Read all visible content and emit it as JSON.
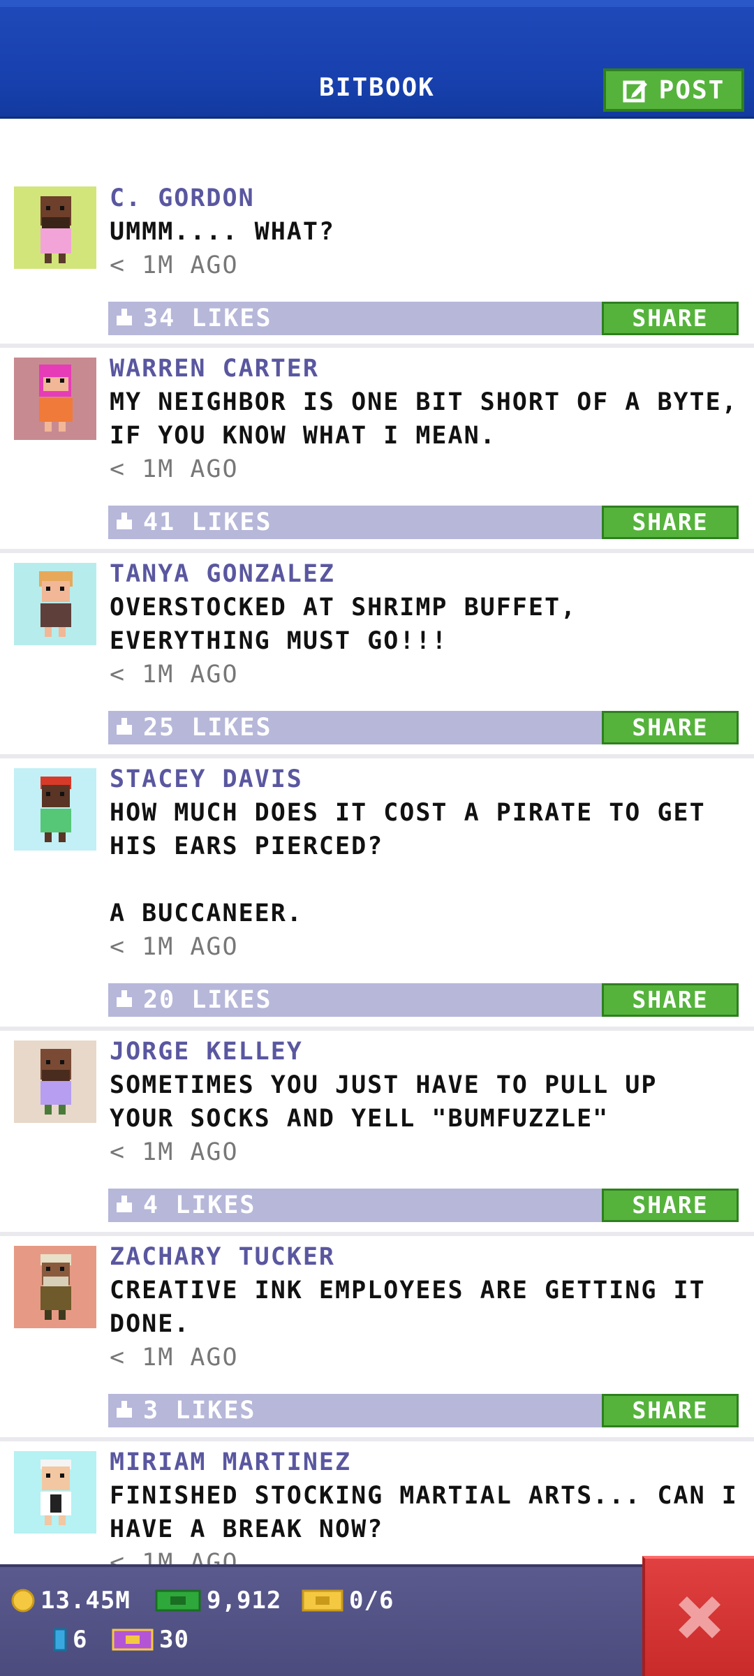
{
  "header": {
    "title": "BITBOOK",
    "post_label": "POST"
  },
  "posts": [
    {
      "author": "C. GORDON",
      "message": "UMMM....  WHAT?",
      "time": "< 1M AGO",
      "likes": "34 LIKES",
      "share": "SHARE",
      "avatar_bg": "#d2e57b"
    },
    {
      "author": "WARREN CARTER",
      "message": "MY NEIGHBOR IS ONE BIT SHORT OF A BYTE,\nIF YOU KNOW WHAT I MEAN.",
      "time": "< 1M AGO",
      "likes": "41 LIKES",
      "share": "SHARE",
      "avatar_bg": "#c88a91"
    },
    {
      "author": "TANYA GONZALEZ",
      "message": "OVERSTOCKED AT SHRIMP BUFFET,\nEVERYTHING MUST GO!!!",
      "time": "< 1M AGO",
      "likes": "25 LIKES",
      "share": "SHARE",
      "avatar_bg": "#b7ecec"
    },
    {
      "author": "STACEY DAVIS",
      "message": "HOW MUCH DOES IT COST A PIRATE TO GET\nHIS EARS PIERCED?\n\nA BUCCANEER.",
      "time": "< 1M AGO",
      "likes": "20 LIKES",
      "share": "SHARE",
      "avatar_bg": "#c3eff6"
    },
    {
      "author": "JORGE KELLEY",
      "message": "SOMETIMES YOU JUST HAVE TO PULL UP\nYOUR SOCKS AND YELL \"BUMFUZZLE\"",
      "time": "< 1M AGO",
      "likes": "4 LIKES",
      "share": "SHARE",
      "avatar_bg": "#e7d8c9"
    },
    {
      "author": "ZACHARY TUCKER",
      "message": "CREATIVE INK EMPLOYEES ARE GETTING IT\nDONE.",
      "time": "< 1M AGO",
      "likes": "3 LIKES",
      "share": "SHARE",
      "avatar_bg": "#e69a85"
    },
    {
      "author": "MIRIAM MARTINEZ",
      "message": "FINISHED STOCKING MARTIAL ARTS... CAN I\nHAVE A BREAK NOW?",
      "time": "< 1M AGO",
      "likes": "",
      "share": "",
      "avatar_bg": "#b6f1f3"
    }
  ],
  "footer": {
    "coins": "13.45M",
    "bux": "9,912",
    "tickets": "0/6",
    "devices": "6",
    "golden_tickets": "30"
  },
  "colors": {
    "header_blue": "#1740ad",
    "share_green": "#55b33c",
    "like_bar": "#b6b7d9",
    "author_purple": "#5a57a0",
    "close_red": "#d93232"
  },
  "icons": {
    "post": "edit-icon",
    "like": "thumbs-up-icon",
    "coin": "coin-icon",
    "bux": "bux-icon",
    "ticket": "ticket-icon",
    "device": "device-icon",
    "golden_ticket": "golden-ticket-icon",
    "close": "close-icon"
  }
}
